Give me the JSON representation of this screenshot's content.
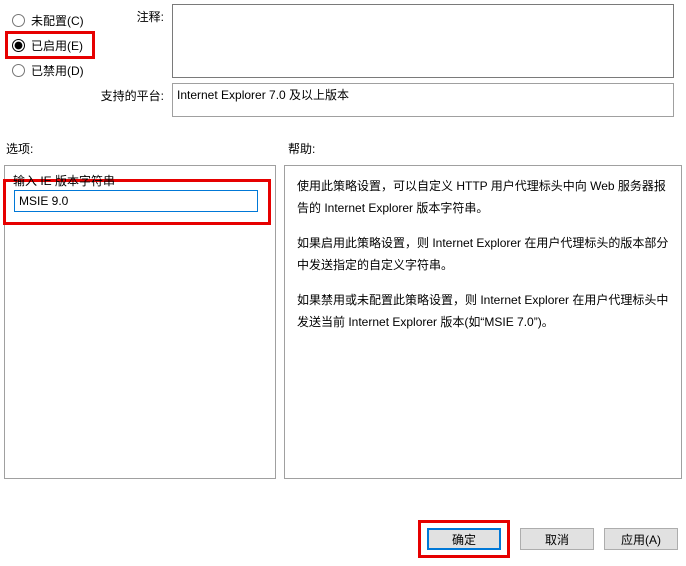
{
  "radios": {
    "not_configured": "未配置(C)",
    "enabled": "已启用(E)",
    "disabled": "已禁用(D)"
  },
  "labels": {
    "comment": "注释:",
    "platform": "支持的平台:",
    "options": "选项:",
    "help": "帮助:",
    "ie_version_input": "输入 IE 版本字符串"
  },
  "values": {
    "comment": "",
    "platform": "Internet Explorer 7.0 及以上版本",
    "ie_version": "MSIE 9.0"
  },
  "help": {
    "p1": "使用此策略设置，可以自定义 HTTP 用户代理标头中向 Web 服务器报告的 Internet Explorer 版本字符串。",
    "p2": "如果启用此策略设置，则 Internet Explorer 在用户代理标头的版本部分中发送指定的自定义字符串。",
    "p3": "如果禁用或未配置此策略设置，则 Internet Explorer 在用户代理标头中发送当前 Internet Explorer 版本(如“MSIE 7.0”)。"
  },
  "buttons": {
    "ok": "确定",
    "cancel": "取消",
    "apply": "应用(A)"
  }
}
